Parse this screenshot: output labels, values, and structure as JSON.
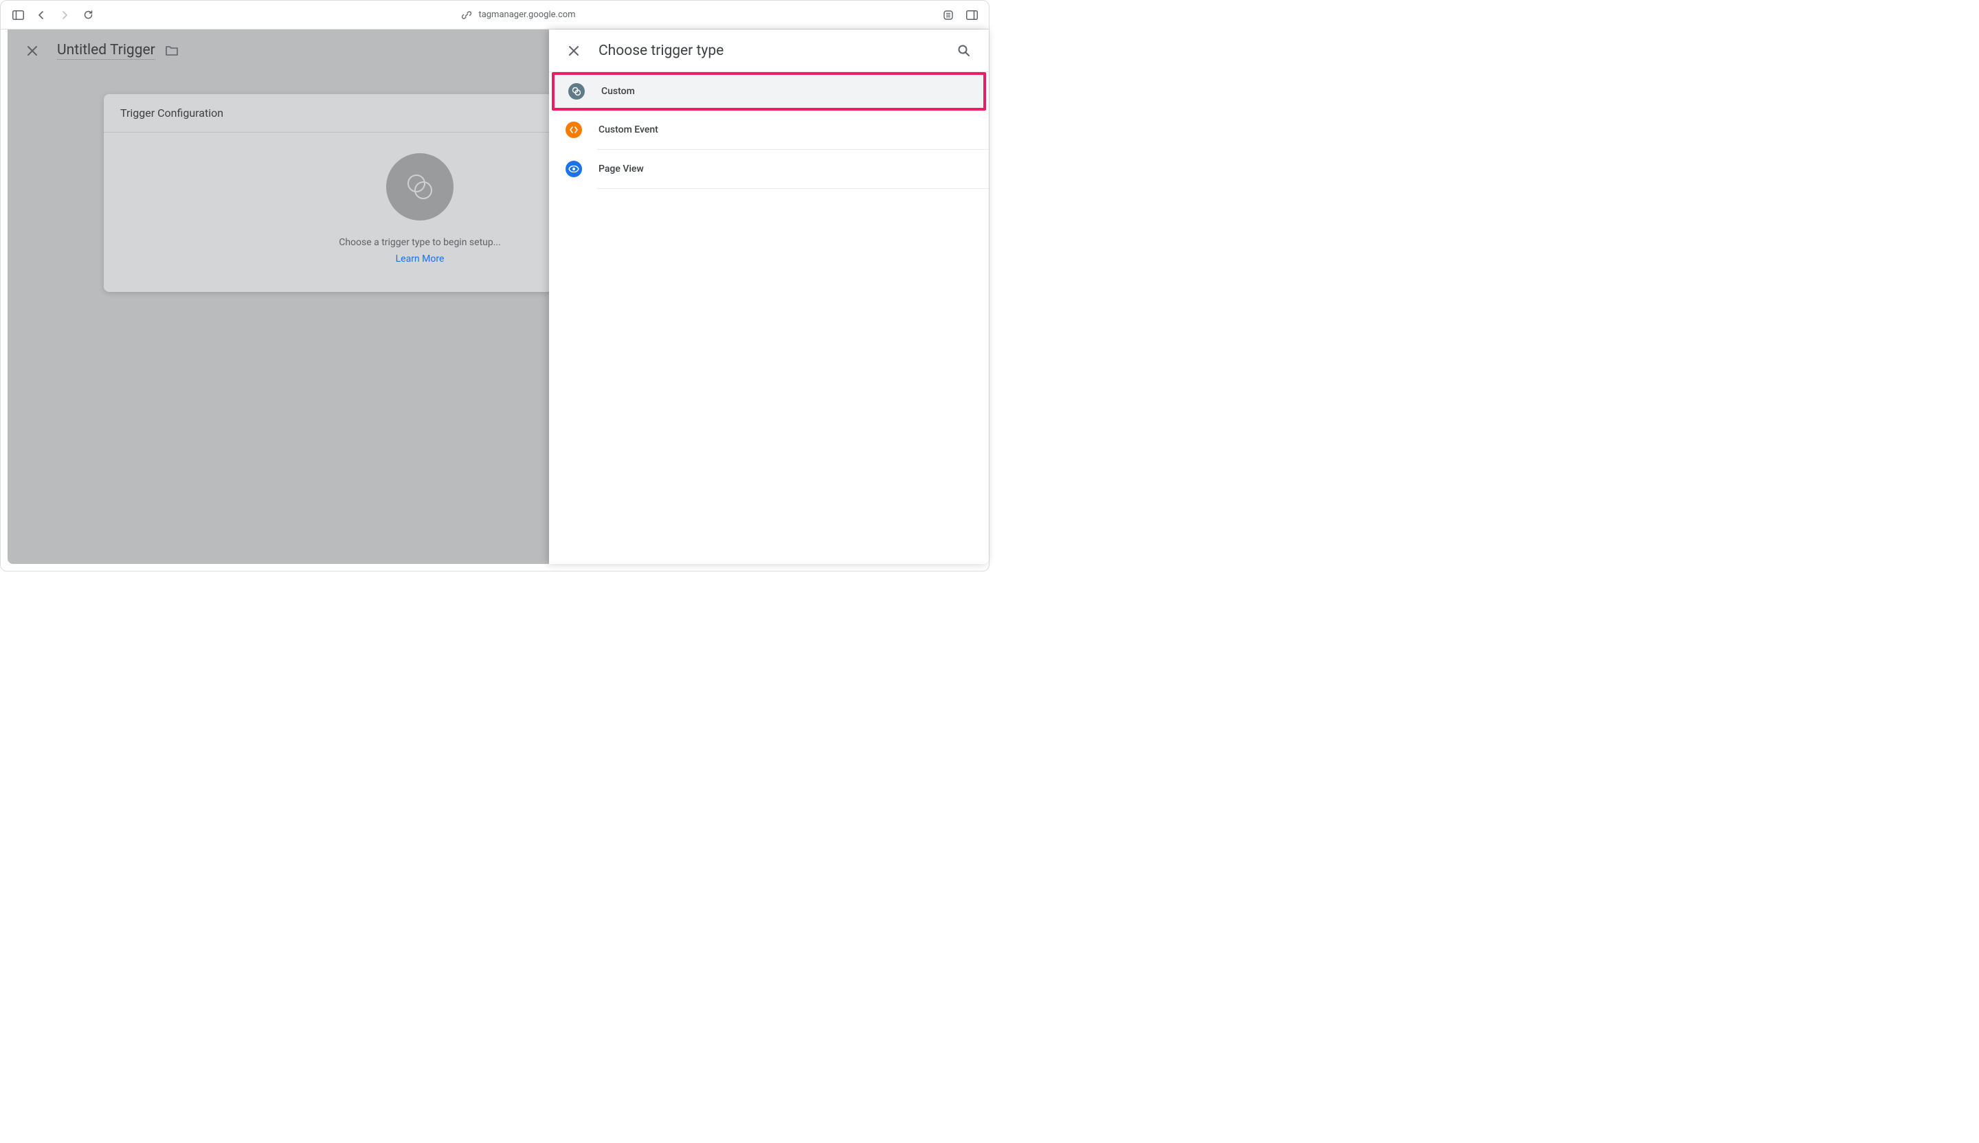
{
  "browser": {
    "url": "tagmanager.google.com"
  },
  "main": {
    "title": "Untitled Trigger",
    "card": {
      "header": "Trigger Configuration",
      "placeholder_text": "Choose a trigger type to begin setup...",
      "learn_more": "Learn More"
    }
  },
  "panel": {
    "title": "Choose trigger type",
    "items": [
      {
        "label": "Custom",
        "icon": "custom",
        "highlighted": true
      },
      {
        "label": "Custom Event",
        "icon": "custom-event",
        "highlighted": false
      },
      {
        "label": "Page View",
        "icon": "page-view",
        "highlighted": false
      }
    ]
  }
}
